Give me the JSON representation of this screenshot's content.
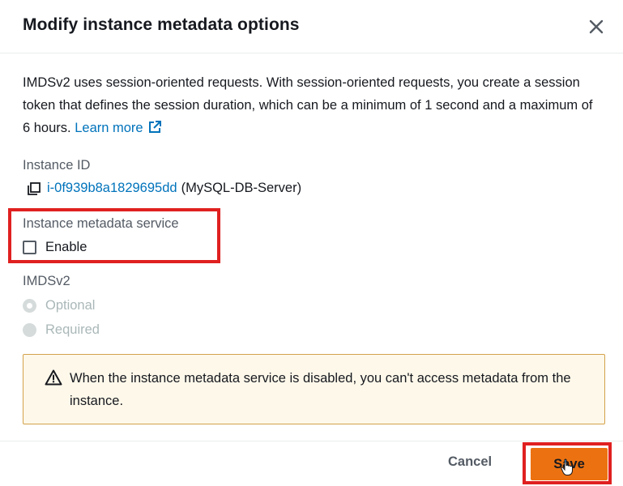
{
  "dialog": {
    "title": "Modify instance metadata options",
    "description": "IMDSv2 uses session-oriented requests. With session-oriented requests, you create a session token that defines the session duration, which can be a minimum of 1 second and a maximum of 6 hours.",
    "learn_more_label": "Learn more"
  },
  "instance": {
    "label": "Instance ID",
    "id": "i-0f939b8a1829695dd",
    "name": "(MySQL-DB-Server)"
  },
  "metadata_service": {
    "label": "Instance metadata service",
    "enable_label": "Enable",
    "enabled": false
  },
  "imdsv2": {
    "label": "IMDSv2",
    "options": [
      "Optional",
      "Required"
    ],
    "selected": "Optional",
    "disabled": true
  },
  "alert": {
    "icon": "warning-icon",
    "text": "When the instance metadata service is disabled, you can't access metadata from the instance."
  },
  "footer": {
    "cancel_label": "Cancel",
    "save_label": "Save"
  },
  "colors": {
    "link": "#0073bb",
    "primary": "#ec7211",
    "highlight": "#e02020",
    "alert_bg": "#fef8ea",
    "alert_border": "#d4a24a"
  }
}
